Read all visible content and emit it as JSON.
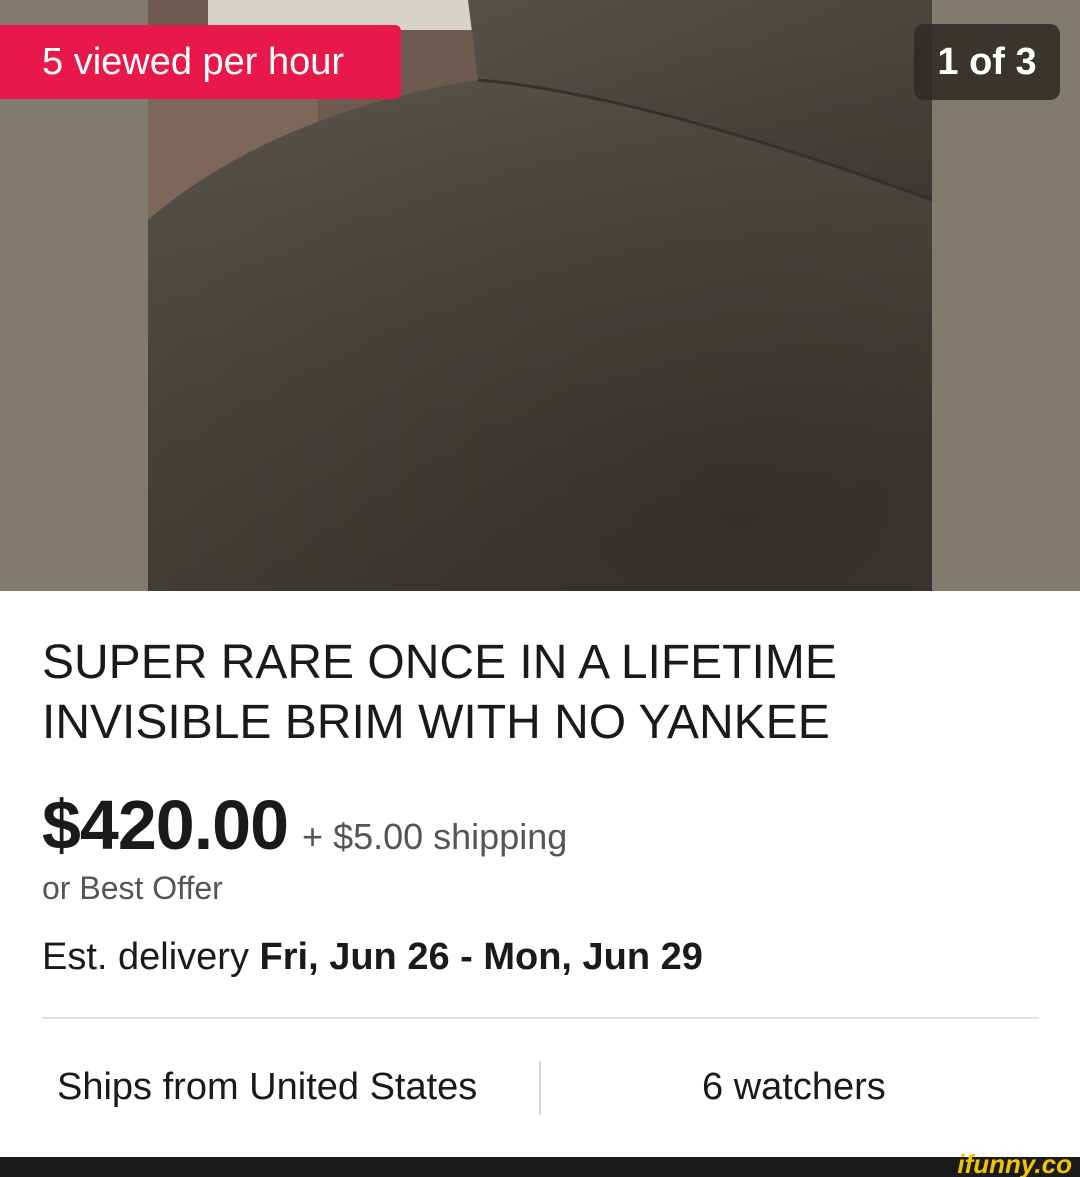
{
  "gallery": {
    "viewed_badge": "5 viewed per hour",
    "counter": "1 of 3"
  },
  "listing": {
    "title_line1": "SUPER RARE ONCE IN A LIFETIME",
    "title_line2": "INVISIBLE BRIM WITH NO YANKEE",
    "price": "$420.00",
    "shipping": "+ $5.00 shipping",
    "best_offer": "or Best Offer",
    "delivery_prefix": "Est. delivery",
    "delivery_dates": "Fri, Jun 26 - Mon, Jun 29",
    "ships_from": "Ships from United States",
    "watchers": "6 watchers"
  },
  "watermark": "ifunny.co",
  "colors": {
    "badge_red": "#e8194a",
    "counter_bg": "#2d2a26",
    "text_primary": "#1a1a1a",
    "text_secondary": "#555555"
  }
}
